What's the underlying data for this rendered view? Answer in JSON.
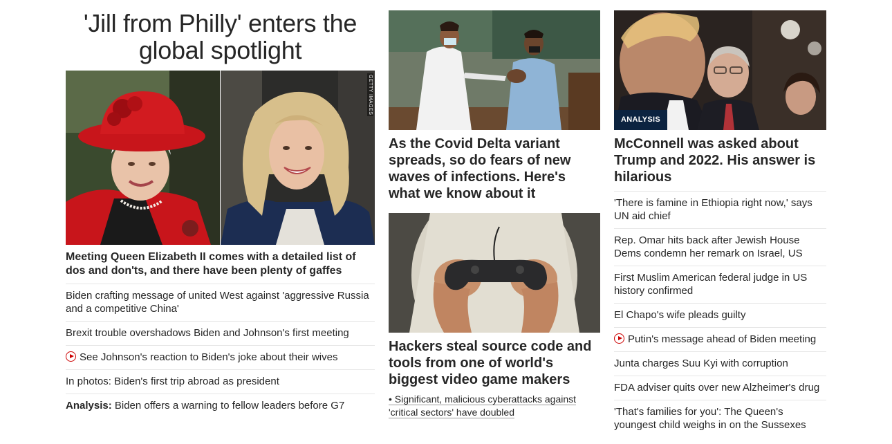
{
  "lead": {
    "title": "'Jill from Philly' enters the global spotlight",
    "image_credit": "GETTY IMAGES",
    "headline": "Meeting Queen Elizabeth II comes with a detailed list of dos and don'ts, and there have been plenty of gaffes",
    "stories": [
      {
        "text": "Biden crafting message of united West against 'aggressive Russia and a competitive China'"
      },
      {
        "text": "Brexit trouble overshadows Biden and Johnson's first meeting"
      },
      {
        "text": "See Johnson's reaction to Biden's joke about their wives",
        "icon": "play-icon"
      },
      {
        "text": "In photos: Biden's first trip abroad as president"
      },
      {
        "label": "Analysis:",
        "text": " Biden offers a warning to fellow leaders before G7"
      }
    ]
  },
  "middle": {
    "card1": {
      "headline": "As the Covid Delta variant spreads, so do fears of new waves of infections. Here's what we know about it"
    },
    "card2": {
      "headline": "Hackers steal source code and tools from one of world's biggest video game makers",
      "bullet": "• Significant, malicious cyberattacks against 'critical sectors' have doubled"
    }
  },
  "right": {
    "badge": "ANALYSIS",
    "headline": "McConnell was asked about Trump and 2022. His answer is hilarious",
    "stories": [
      {
        "text": "'There is famine in Ethiopia right now,' says UN aid chief"
      },
      {
        "text": "Rep. Omar hits back after Jewish House Dems condemn her remark on Israel, US"
      },
      {
        "text": "First Muslim American federal judge in US history confirmed"
      },
      {
        "text": "El Chapo's wife pleads guilty"
      },
      {
        "text": "Putin's message ahead of Biden meeting",
        "icon": "play-icon"
      },
      {
        "text": "Junta charges Suu Kyi with corruption"
      },
      {
        "text": "FDA adviser quits over new Alzheimer's drug"
      },
      {
        "text": "'That's families for you': The Queen's youngest child weighs in on the Sussexes"
      }
    ]
  },
  "colors": {
    "accent_red": "#cc0000",
    "badge_navy": "#0c2340",
    "text": "#262626",
    "rule": "#e6e6e6"
  }
}
